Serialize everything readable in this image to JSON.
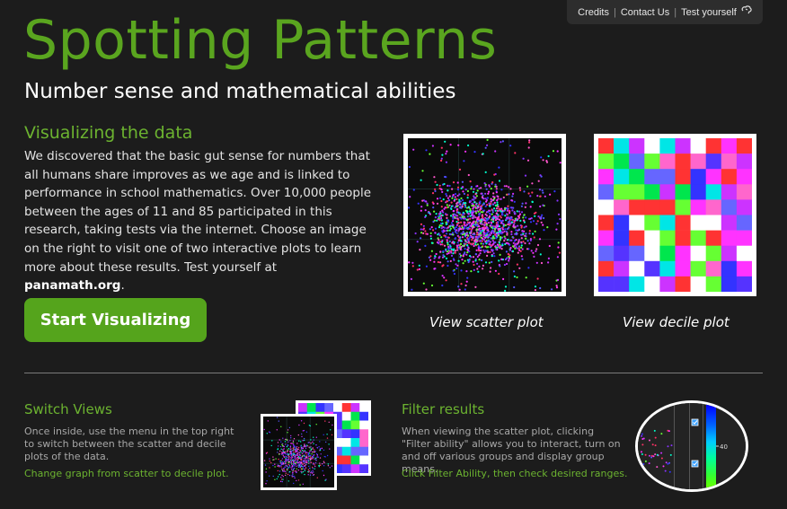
{
  "nav": {
    "credits": "Credits",
    "sep1": "|",
    "contact": "Contact Us",
    "sep2": "|",
    "test": "Test yourself"
  },
  "header": {
    "title": "Spotting Patterns",
    "subtitle": "Number sense and mathematical abilities"
  },
  "visualize": {
    "heading": "Visualizing the data",
    "body": "We discovered that the basic gut sense for numbers that all humans share improves as we age and is linked to performance in school mathematics. Over 10,000 people between the ages of 11 and 85 participated in this research, taking tests via the internet. Choose an image on the right to visit one of two interactive plots to learn more about these results. Test yourself at ",
    "link": "panamath.org",
    "end": ".",
    "button": "Start Visualizing"
  },
  "thumbnails": {
    "scatter_caption": "View scatter plot",
    "decile_caption": "View decile plot"
  },
  "switch_views": {
    "heading": "Switch Views",
    "body": "Once inside, use the menu in the top right to switch between the scatter and decile plots of the data.",
    "hint": "Change graph from scatter to decile plot."
  },
  "filter": {
    "heading": "Filter results",
    "body": "When viewing the scatter plot, clicking \"Filter ability\" allows you to interact, turn on and off various groups and display group means.",
    "hint": "Click Filter Ability, then check desired ranges.",
    "slider_value": "40"
  },
  "colors": {
    "brand_green": "#5aa51f",
    "button_green": "#55a41c",
    "background": "#1c1c1c",
    "palette": [
      "#ff33ff",
      "#ffffff",
      "#3333ff",
      "#00e64d",
      "#ff3333",
      "#00e6e6",
      "#cc33ff",
      "#66ff33",
      "#6666ff",
      "#ff66cc"
    ]
  },
  "icons": {
    "test_yourself": "brain-icon",
    "filter_checkbox": "checkbox-icon"
  }
}
